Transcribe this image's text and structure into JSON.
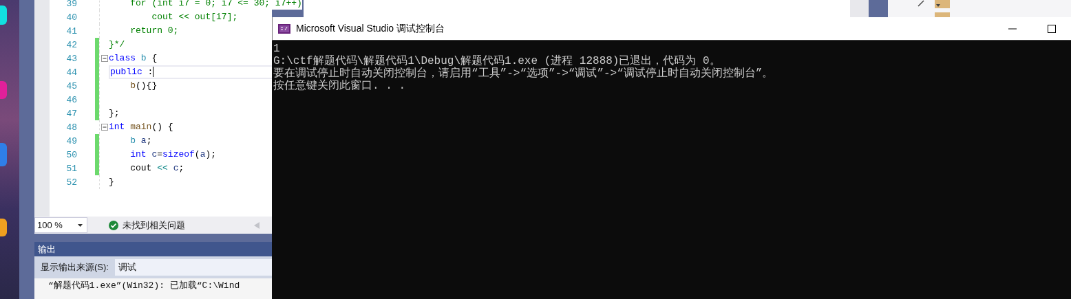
{
  "editor": {
    "lines": [
      {
        "number": "39",
        "changed": false,
        "collapsible": false,
        "current": false,
        "tokens": [
          {
            "kind": "comment",
            "text": "    for (int i7 = 0; i7 <= 30; i7++)"
          }
        ]
      },
      {
        "number": "40",
        "changed": false,
        "collapsible": false,
        "current": false,
        "tokens": [
          {
            "kind": "comment",
            "text": "        cout << out[i7];"
          }
        ]
      },
      {
        "number": "41",
        "changed": false,
        "collapsible": false,
        "current": false,
        "tokens": [
          {
            "kind": "comment",
            "text": "    return 0;"
          }
        ]
      },
      {
        "number": "42",
        "changed": true,
        "collapsible": false,
        "current": false,
        "tokens": [
          {
            "kind": "comment",
            "text": "}*/"
          }
        ]
      },
      {
        "number": "43",
        "changed": true,
        "collapsible": true,
        "current": false,
        "tokens": [
          {
            "kind": "keyword",
            "text": "class"
          },
          {
            "kind": "type",
            "text": " b"
          },
          {
            "kind": "plain",
            "text": " {"
          }
        ]
      },
      {
        "number": "44",
        "changed": true,
        "collapsible": false,
        "current": true,
        "tokens": [
          {
            "kind": "keyword",
            "text": "public"
          },
          {
            "kind": "plain",
            "text": " :"
          }
        ]
      },
      {
        "number": "45",
        "changed": true,
        "collapsible": false,
        "current": false,
        "tokens": [
          {
            "kind": "function",
            "text": "    b"
          },
          {
            "kind": "plain",
            "text": "(){}"
          }
        ]
      },
      {
        "number": "46",
        "changed": true,
        "collapsible": false,
        "current": false
      },
      {
        "number": "47",
        "changed": true,
        "collapsible": false,
        "current": false,
        "tokens": [
          {
            "kind": "plain",
            "text": "};"
          }
        ]
      },
      {
        "number": "48",
        "changed": false,
        "collapsible": true,
        "current": false,
        "tokens": [
          {
            "kind": "keyword",
            "text": "int"
          },
          {
            "kind": "function",
            "text": " main"
          },
          {
            "kind": "plain",
            "text": "() {"
          }
        ]
      },
      {
        "number": "49",
        "changed": true,
        "collapsible": false,
        "current": false,
        "tokens": [
          {
            "kind": "type",
            "text": "    b"
          },
          {
            "kind": "variable",
            "text": " a"
          },
          {
            "kind": "plain",
            "text": ";"
          }
        ]
      },
      {
        "number": "50",
        "changed": true,
        "collapsible": false,
        "current": false,
        "tokens": [
          {
            "kind": "keyword",
            "text": "    int"
          },
          {
            "kind": "variable",
            "text": " c"
          },
          {
            "kind": "plain",
            "text": "="
          },
          {
            "kind": "keyword",
            "text": "sizeof"
          },
          {
            "kind": "plain",
            "text": "("
          },
          {
            "kind": "variable",
            "text": "a"
          },
          {
            "kind": "plain",
            "text": ");"
          }
        ]
      },
      {
        "number": "51",
        "changed": true,
        "collapsible": false,
        "current": false,
        "tokens": [
          {
            "kind": "plain",
            "text": "    cout "
          },
          {
            "kind": "operator",
            "text": "<<"
          },
          {
            "kind": "variable",
            "text": " c"
          },
          {
            "kind": "plain",
            "text": ";"
          }
        ]
      },
      {
        "number": "52",
        "changed": false,
        "collapsible": false,
        "current": false,
        "tokens": [
          {
            "kind": "plain",
            "text": "}"
          }
        ]
      }
    ],
    "zoom": "100 %",
    "status": "未找到相关问题"
  },
  "output_panel": {
    "title": "输出",
    "source_label": "显示输出来源(S):",
    "source_value": "调试",
    "lines": [
      "“解题代码1.exe”(Win32): 已加载“C:\\Wind"
    ]
  },
  "console_window": {
    "title": "Microsoft Visual Studio 调试控制台",
    "lines": [
      "1",
      "G:\\ctf解题代码\\解题代码1\\Debug\\解题代码1.exe (进程 12888)已退出，代码为 0。",
      "要在调试停止时自动关闭控制台，请启用“工具”->“选项”->“调试”->“调试停止时自动关闭控制台”。",
      "按任意键关闭此窗口. . ."
    ]
  }
}
